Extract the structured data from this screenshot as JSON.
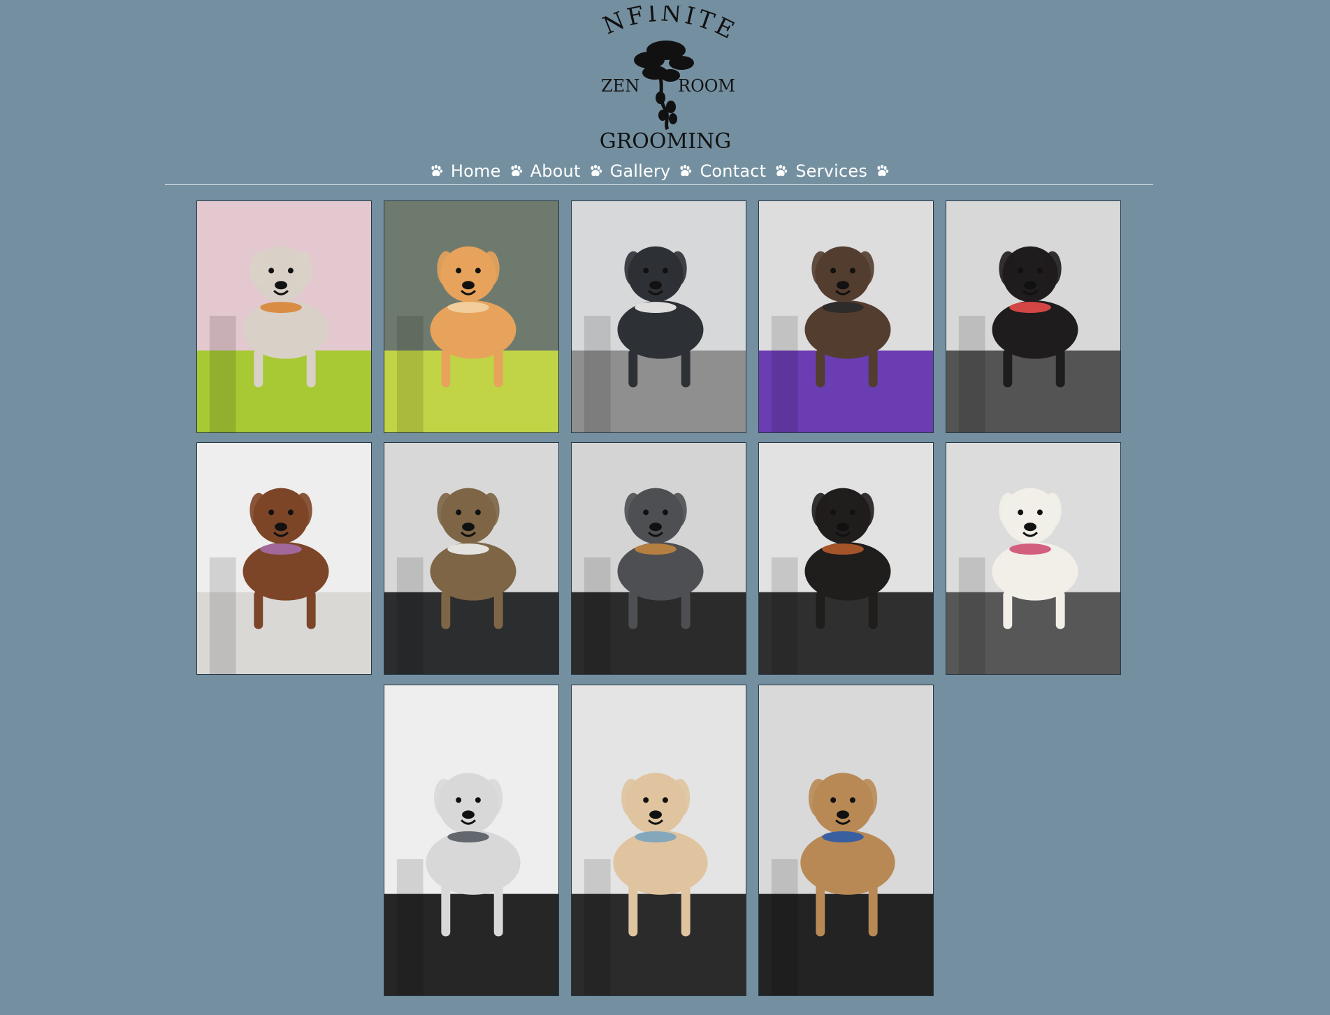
{
  "site": {
    "logo": {
      "line1": "INFINITE",
      "left_word": "ZEN",
      "right_word": "ROOM",
      "line3": "GROOMING"
    },
    "nav": [
      {
        "label": "Home"
      },
      {
        "label": "About"
      },
      {
        "label": "Gallery"
      },
      {
        "label": "Contact"
      },
      {
        "label": "Services"
      }
    ]
  },
  "gallery": {
    "photos": [
      {
        "dog_color": "#d9d1c7",
        "background": "#e3c8cf",
        "table": "#a7c934",
        "accent": "#d88535"
      },
      {
        "dog_color": "#e7a35b",
        "background": "#6f7a6e",
        "table": "#c1d446",
        "accent": "#f2d3a3"
      },
      {
        "dog_color": "#2d3034",
        "background": "#d6d8da",
        "table": "#8f8f8f",
        "accent": "#f4f2ef"
      },
      {
        "dog_color": "#533d2f",
        "background": "#dddddd",
        "table": "#6b3db3",
        "accent": "#2a2a2a"
      },
      {
        "dog_color": "#1f1c1d",
        "background": "#d8d8d8",
        "table": "#545454",
        "accent": "#e84b4b"
      },
      {
        "dog_color": "#7d4527",
        "background": "#eeeeee",
        "table": "#d9d8d5",
        "accent": "#a66ca8"
      },
      {
        "dog_color": "#7d6546",
        "background": "#d8d8d8",
        "table": "#2b2d2f",
        "accent": "#f0f0f0"
      },
      {
        "dog_color": "#4e4f52",
        "background": "#d4d4d4",
        "table": "#2b2b2b",
        "accent": "#c0843f"
      },
      {
        "dog_color": "#201d1d",
        "background": "#e2e2e2",
        "table": "#2f2f2f",
        "accent": "#b45b2b"
      },
      {
        "dog_color": "#f1efe8",
        "background": "#dcdcdc",
        "table": "#575757",
        "accent": "#cf4f73"
      },
      {
        "dog_color": "#d8d8d8",
        "background": "#eeeeee",
        "table": "#262626",
        "accent": "#575b63"
      },
      {
        "dog_color": "#dfc49f",
        "background": "#e4e4e4",
        "table": "#2b2b2b",
        "accent": "#7ba4bf"
      },
      {
        "dog_color": "#b88955",
        "background": "#d9d9d9",
        "table": "#232323",
        "accent": "#2c5ba8"
      }
    ]
  }
}
